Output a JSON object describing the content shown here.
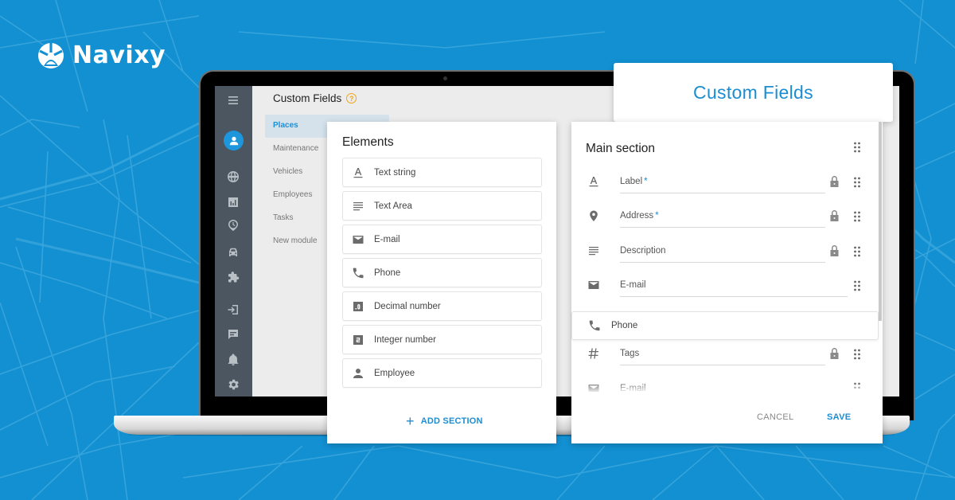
{
  "brand": {
    "name": "Navixy",
    "background_color": "#1290d2",
    "accent_color": "#1b8ed2"
  },
  "hero_title": "Custom Fields",
  "app": {
    "title": "Custom Fields",
    "help_icon": "?",
    "sidebar_icons": [
      "menu-icon",
      "user-avatar-icon",
      "globe-icon",
      "reports-icon",
      "time-place-icon",
      "car-icon",
      "puzzle-icon",
      "login-icon",
      "chat-icon",
      "bell-icon",
      "gear-icon"
    ],
    "modules": [
      {
        "label": "Places",
        "active": true
      },
      {
        "label": "Maintenance",
        "active": false
      },
      {
        "label": "Vehicles",
        "active": false
      },
      {
        "label": "Employees",
        "active": false
      },
      {
        "label": "Tasks",
        "active": false
      },
      {
        "label": "New module",
        "active": false
      }
    ]
  },
  "elements_panel": {
    "title": "Elements",
    "items": [
      {
        "label": "Text string",
        "icon": "text-string-icon"
      },
      {
        "label": "Text Area",
        "icon": "text-area-icon"
      },
      {
        "label": "E-mail",
        "icon": "email-icon"
      },
      {
        "label": "Phone",
        "icon": "phone-icon"
      },
      {
        "label": "Decimal number",
        "icon": "decimal-number-icon"
      },
      {
        "label": "Integer number",
        "icon": "integer-number-icon"
      },
      {
        "label": "Employee",
        "icon": "employee-icon"
      }
    ],
    "add_section_label": "ADD SECTION"
  },
  "main_section": {
    "title": "Main section",
    "fields": [
      {
        "label": "Label",
        "required": "*",
        "icon": "text-string-icon",
        "locked": true
      },
      {
        "label": "Address",
        "required": "*",
        "icon": "location-pin-icon",
        "locked": true
      },
      {
        "label": "Description",
        "required": "",
        "icon": "text-area-icon",
        "locked": true
      },
      {
        "label": "E-mail",
        "required": "",
        "icon": "email-icon",
        "locked": false
      },
      {
        "label": "Tags",
        "required": "",
        "icon": "hash-icon",
        "locked": true
      },
      {
        "label": "E-mail",
        "required": "",
        "icon": "email-icon",
        "locked": false
      }
    ],
    "dragged_item": {
      "label": "Phone",
      "icon": "phone-icon"
    },
    "cancel_label": "CANCEL",
    "save_label": "SAVE"
  }
}
